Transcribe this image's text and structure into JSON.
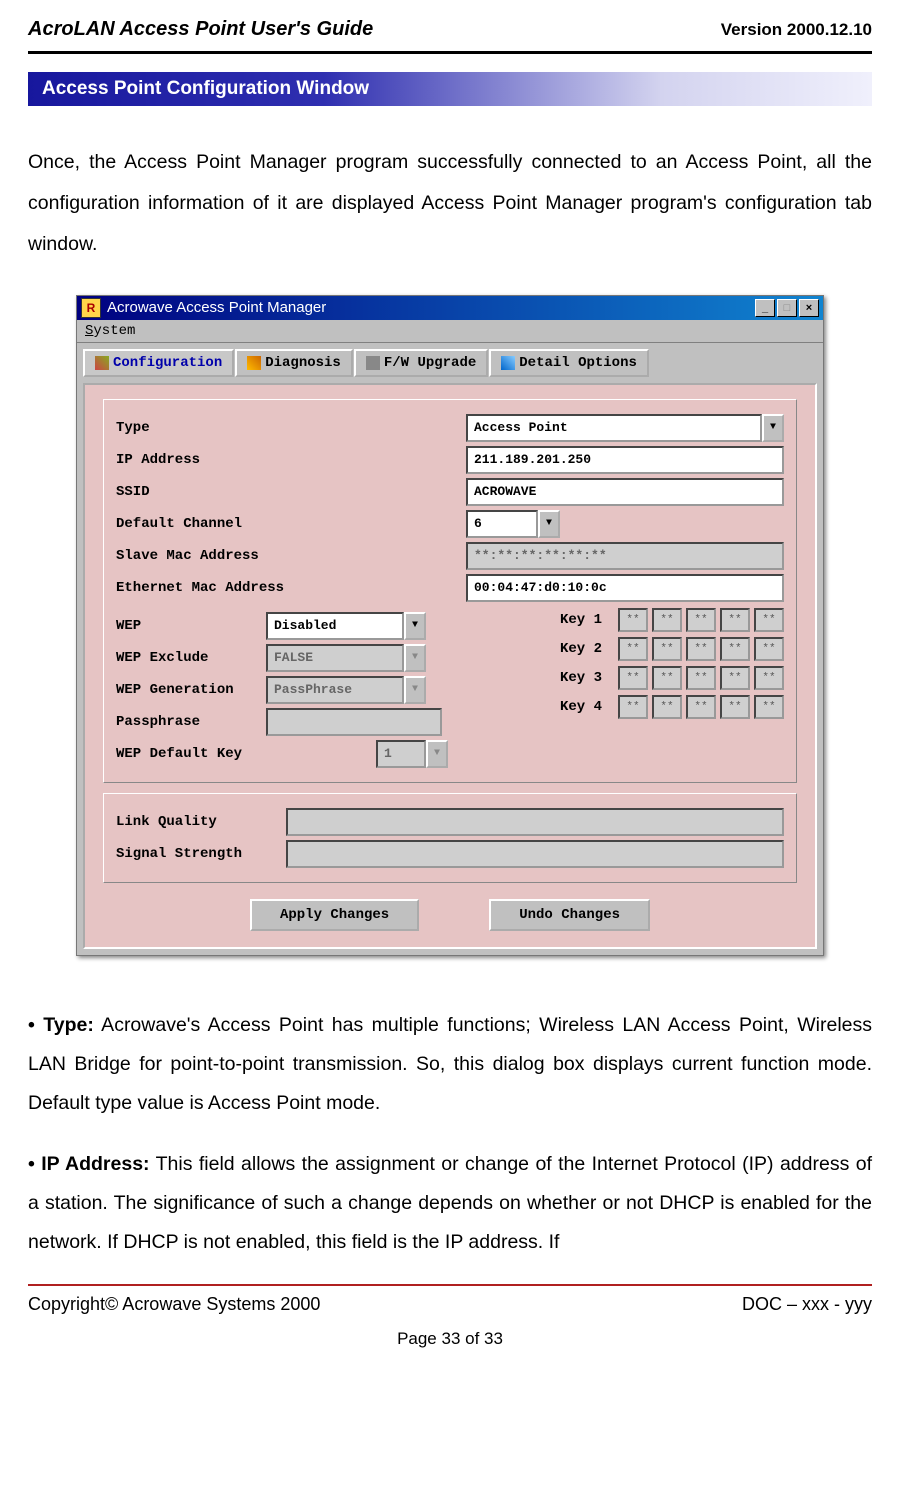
{
  "header": {
    "title": "AcroLAN Access Point User's Guide",
    "version": "Version 2000.12.10"
  },
  "section_title": "Access Point Configuration Window",
  "intro_text": "Once, the Access Point Manager program successfully connected to an Access Point, all the configuration information of it are displayed Access Point Manager program's configuration tab window.",
  "window": {
    "titlebar_icon_letter": "R",
    "title": "Acrowave Access Point Manager",
    "menubar": {
      "system": "System"
    },
    "tabs": {
      "configuration": "Configuration",
      "diagnosis": "Diagnosis",
      "fw_upgrade": "F/W Upgrade",
      "detail_options": "Detail Options"
    },
    "labels": {
      "type": "Type",
      "ip_address": "IP Address",
      "ssid": "SSID",
      "default_channel": "Default Channel",
      "slave_mac": "Slave Mac Address",
      "eth_mac": "Ethernet Mac Address",
      "wep": "WEP",
      "wep_exclude": "WEP Exclude",
      "wep_generation": "WEP Generation",
      "passphrase": "Passphrase",
      "wep_default_key": "WEP Default Key",
      "key1": "Key 1",
      "key2": "Key 2",
      "key3": "Key 3",
      "key4": "Key 4",
      "link_quality": "Link Quality",
      "signal_strength": "Signal Strength"
    },
    "values": {
      "type": "Access Point",
      "ip_address": "211.189.201.250",
      "ssid": "ACROWAVE",
      "default_channel": "6",
      "slave_mac": "**:**:**:**:**:**",
      "eth_mac": "00:04:47:d0:10:0c",
      "wep": "Disabled",
      "wep_exclude": "FALSE",
      "wep_generation": "PassPhrase",
      "passphrase": "",
      "wep_default_key": "1",
      "keycell": "**",
      "link_quality": "",
      "signal_strength": ""
    },
    "buttons": {
      "apply": "Apply Changes",
      "undo": "Undo Changes"
    }
  },
  "bullets": {
    "type_label": "Type:",
    "type_text": " Acrowave's Access Point has multiple functions; Wireless LAN Access Point, Wireless LAN Bridge for point-to-point transmission. So, this dialog box displays current function mode. Default type value is Access Point mode.",
    "ip_label": "IP Address:",
    "ip_text": " This field allows the assignment or change of the Internet Protocol (IP) address of a station. The significance of such a change depends on whether or not DHCP is enabled for the network. If DHCP is not enabled, this field is the IP address. If"
  },
  "footer": {
    "copyright": "Copyright© Acrowave Systems 2000",
    "doc": "DOC – xxx - yyy",
    "page": "Page 33 of 33"
  }
}
